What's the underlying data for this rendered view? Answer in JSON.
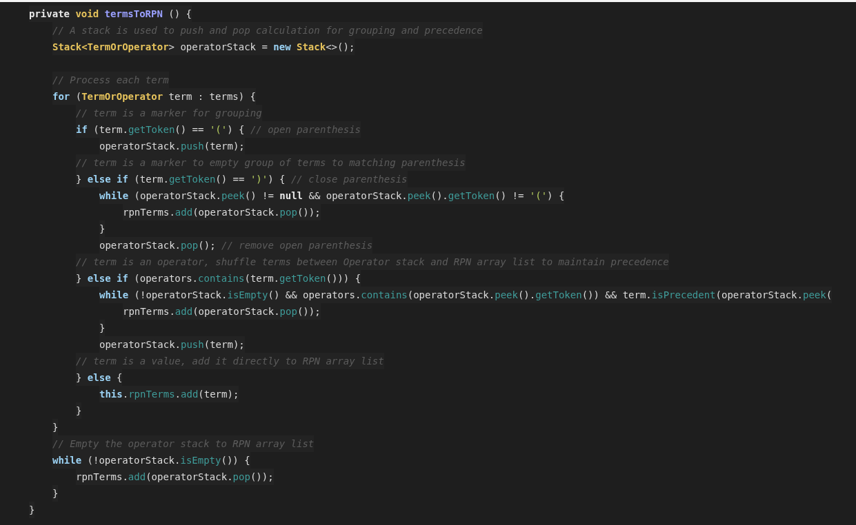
{
  "editor": {
    "lines": [
      {
        "tokens": [
          {
            "kind": "bold",
            "text": "private "
          },
          {
            "kind": "type",
            "text": "void "
          },
          {
            "kind": "function",
            "text": "termsToRPN"
          },
          {
            "kind": "plain",
            "text": " () {"
          }
        ],
        "children": [
          {
            "tokens": [
              {
                "kind": "comment",
                "text": "// A stack is used to push and pop calculation for grouping and precedence"
              }
            ]
          },
          {
            "tokens": [
              {
                "kind": "type",
                "text": "Stack<TermOrOperator"
              },
              {
                "kind": "plain",
                "text": "> operatorStack = "
              },
              {
                "kind": "keyword",
                "text": "new "
              },
              {
                "kind": "type",
                "text": "Stack"
              },
              {
                "kind": "plain",
                "text": "<>();"
              }
            ]
          },
          {
            "blank_before": true,
            "tokens": [
              {
                "kind": "comment",
                "text": "// Process each term"
              }
            ]
          },
          {
            "tokens": [
              {
                "kind": "keyword",
                "text": "for"
              },
              {
                "kind": "plain",
                "text": " ("
              },
              {
                "kind": "type",
                "text": "TermOrOperator"
              },
              {
                "kind": "plain",
                "text": " term : terms) {"
              }
            ],
            "children": [
              {
                "tokens": [
                  {
                    "kind": "comment",
                    "text": "// term is a marker for grouping"
                  }
                ]
              },
              {
                "tokens": [
                  {
                    "kind": "keyword",
                    "text": "if"
                  },
                  {
                    "kind": "plain",
                    "text": " (term."
                  },
                  {
                    "kind": "method",
                    "text": "getToken"
                  },
                  {
                    "kind": "plain",
                    "text": "() == "
                  },
                  {
                    "kind": "string",
                    "text": "'('"
                  },
                  {
                    "kind": "plain",
                    "text": ") { "
                  },
                  {
                    "kind": "comment",
                    "text": "// open parenthesis"
                  }
                ],
                "children": [
                  {
                    "tokens": [
                      {
                        "kind": "plain",
                        "text": "operatorStack."
                      },
                      {
                        "kind": "method",
                        "text": "push"
                      },
                      {
                        "kind": "plain",
                        "text": "(term);"
                      }
                    ]
                  }
                ]
              },
              {
                "tokens": [
                  {
                    "kind": "comment",
                    "text": "// term is a marker to empty group of terms to matching parenthesis"
                  }
                ]
              },
              {
                "tokens": [
                  {
                    "kind": "plain",
                    "text": "} "
                  },
                  {
                    "kind": "keyword",
                    "text": "else if"
                  },
                  {
                    "kind": "plain",
                    "text": " (term."
                  },
                  {
                    "kind": "method",
                    "text": "getToken"
                  },
                  {
                    "kind": "plain",
                    "text": "() == "
                  },
                  {
                    "kind": "string",
                    "text": "')'"
                  },
                  {
                    "kind": "plain",
                    "text": ") { "
                  },
                  {
                    "kind": "comment",
                    "text": "// close parenthesis"
                  }
                ],
                "children": [
                  {
                    "tokens": [
                      {
                        "kind": "keyword",
                        "text": "while"
                      },
                      {
                        "kind": "plain",
                        "text": " (operatorStack."
                      },
                      {
                        "kind": "method",
                        "text": "peek"
                      },
                      {
                        "kind": "plain",
                        "text": "() != "
                      },
                      {
                        "kind": "bold",
                        "text": "null"
                      },
                      {
                        "kind": "plain",
                        "text": " && operatorStack."
                      },
                      {
                        "kind": "method",
                        "text": "peek"
                      },
                      {
                        "kind": "plain",
                        "text": "()."
                      },
                      {
                        "kind": "method",
                        "text": "getToken"
                      },
                      {
                        "kind": "plain",
                        "text": "() != "
                      },
                      {
                        "kind": "string",
                        "text": "'('"
                      },
                      {
                        "kind": "plain",
                        "text": ") {"
                      }
                    ],
                    "children": [
                      {
                        "tokens": [
                          {
                            "kind": "plain",
                            "text": "rpnTerms."
                          },
                          {
                            "kind": "method",
                            "text": "add"
                          },
                          {
                            "kind": "plain",
                            "text": "(operatorStack."
                          },
                          {
                            "kind": "method",
                            "text": "pop"
                          },
                          {
                            "kind": "plain",
                            "text": "());"
                          }
                        ]
                      }
                    ]
                  },
                  {
                    "tokens": [
                      {
                        "kind": "plain",
                        "text": "}"
                      }
                    ]
                  },
                  {
                    "tokens": [
                      {
                        "kind": "plain",
                        "text": "operatorStack."
                      },
                      {
                        "kind": "method",
                        "text": "pop"
                      },
                      {
                        "kind": "plain",
                        "text": "(); "
                      },
                      {
                        "kind": "comment",
                        "text": "// remove open parenthesis"
                      }
                    ]
                  }
                ]
              },
              {
                "tokens": [
                  {
                    "kind": "comment",
                    "text": "// term is an operator, shuffle terms between Operator stack and RPN array list to maintain precedence"
                  }
                ]
              },
              {
                "tokens": [
                  {
                    "kind": "plain",
                    "text": "} "
                  },
                  {
                    "kind": "keyword",
                    "text": "else if"
                  },
                  {
                    "kind": "plain",
                    "text": " (operators."
                  },
                  {
                    "kind": "method",
                    "text": "contains"
                  },
                  {
                    "kind": "plain",
                    "text": "(term."
                  },
                  {
                    "kind": "method",
                    "text": "getToken"
                  },
                  {
                    "kind": "plain",
                    "text": "())) {"
                  }
                ],
                "children": [
                  {
                    "tokens": [
                      {
                        "kind": "keyword",
                        "text": "while"
                      },
                      {
                        "kind": "plain",
                        "text": " (!operatorStack."
                      },
                      {
                        "kind": "method",
                        "text": "isEmpty"
                      },
                      {
                        "kind": "plain",
                        "text": "() && operators."
                      },
                      {
                        "kind": "method",
                        "text": "contains"
                      },
                      {
                        "kind": "plain",
                        "text": "(operatorStack."
                      },
                      {
                        "kind": "method",
                        "text": "peek"
                      },
                      {
                        "kind": "plain",
                        "text": "()."
                      },
                      {
                        "kind": "method",
                        "text": "getToken"
                      },
                      {
                        "kind": "plain",
                        "text": "()) && term."
                      },
                      {
                        "kind": "method",
                        "text": "isPrecedent"
                      },
                      {
                        "kind": "plain",
                        "text": "(operatorStack."
                      },
                      {
                        "kind": "method",
                        "text": "peek"
                      },
                      {
                        "kind": "plain",
                        "text": "("
                      }
                    ],
                    "children": [
                      {
                        "tokens": [
                          {
                            "kind": "plain",
                            "text": "rpnTerms."
                          },
                          {
                            "kind": "method",
                            "text": "add"
                          },
                          {
                            "kind": "plain",
                            "text": "(operatorStack."
                          },
                          {
                            "kind": "method",
                            "text": "pop"
                          },
                          {
                            "kind": "plain",
                            "text": "());"
                          }
                        ]
                      }
                    ]
                  },
                  {
                    "tokens": [
                      {
                        "kind": "plain",
                        "text": "}"
                      }
                    ]
                  },
                  {
                    "tokens": [
                      {
                        "kind": "plain",
                        "text": "operatorStack."
                      },
                      {
                        "kind": "method",
                        "text": "push"
                      },
                      {
                        "kind": "plain",
                        "text": "(term);"
                      }
                    ]
                  }
                ]
              },
              {
                "tokens": [
                  {
                    "kind": "comment",
                    "text": "// term is a value, add it directly to RPN array list"
                  }
                ]
              },
              {
                "tokens": [
                  {
                    "kind": "plain",
                    "text": "} "
                  },
                  {
                    "kind": "keyword",
                    "text": "else"
                  },
                  {
                    "kind": "plain",
                    "text": " {"
                  }
                ],
                "children": [
                  {
                    "tokens": [
                      {
                        "kind": "keyword",
                        "text": "this"
                      },
                      {
                        "kind": "plain",
                        "text": "."
                      },
                      {
                        "kind": "method",
                        "text": "rpnTerms"
                      },
                      {
                        "kind": "plain",
                        "text": "."
                      },
                      {
                        "kind": "method",
                        "text": "add"
                      },
                      {
                        "kind": "plain",
                        "text": "(term);"
                      }
                    ]
                  }
                ]
              },
              {
                "tokens": [
                  {
                    "kind": "plain",
                    "text": "}"
                  }
                ]
              }
            ]
          },
          {
            "tokens": [
              {
                "kind": "plain",
                "text": "}"
              }
            ]
          },
          {
            "tokens": [
              {
                "kind": "comment",
                "text": "// Empty the operator stack to RPN array list"
              }
            ]
          },
          {
            "tokens": [
              {
                "kind": "keyword",
                "text": "while"
              },
              {
                "kind": "plain",
                "text": " (!operatorStack."
              },
              {
                "kind": "method",
                "text": "isEmpty"
              },
              {
                "kind": "plain",
                "text": "()) {"
              }
            ],
            "children": [
              {
                "tokens": [
                  {
                    "kind": "plain",
                    "text": "rpnTerms."
                  },
                  {
                    "kind": "method",
                    "text": "add"
                  },
                  {
                    "kind": "plain",
                    "text": "(operatorStack."
                  },
                  {
                    "kind": "method",
                    "text": "pop"
                  },
                  {
                    "kind": "plain",
                    "text": "());"
                  }
                ]
              }
            ]
          },
          {
            "tokens": [
              {
                "kind": "plain",
                "text": "}"
              }
            ]
          }
        ]
      },
      {
        "tokens": [
          {
            "kind": "plain",
            "text": "}"
          }
        ]
      }
    ]
  }
}
